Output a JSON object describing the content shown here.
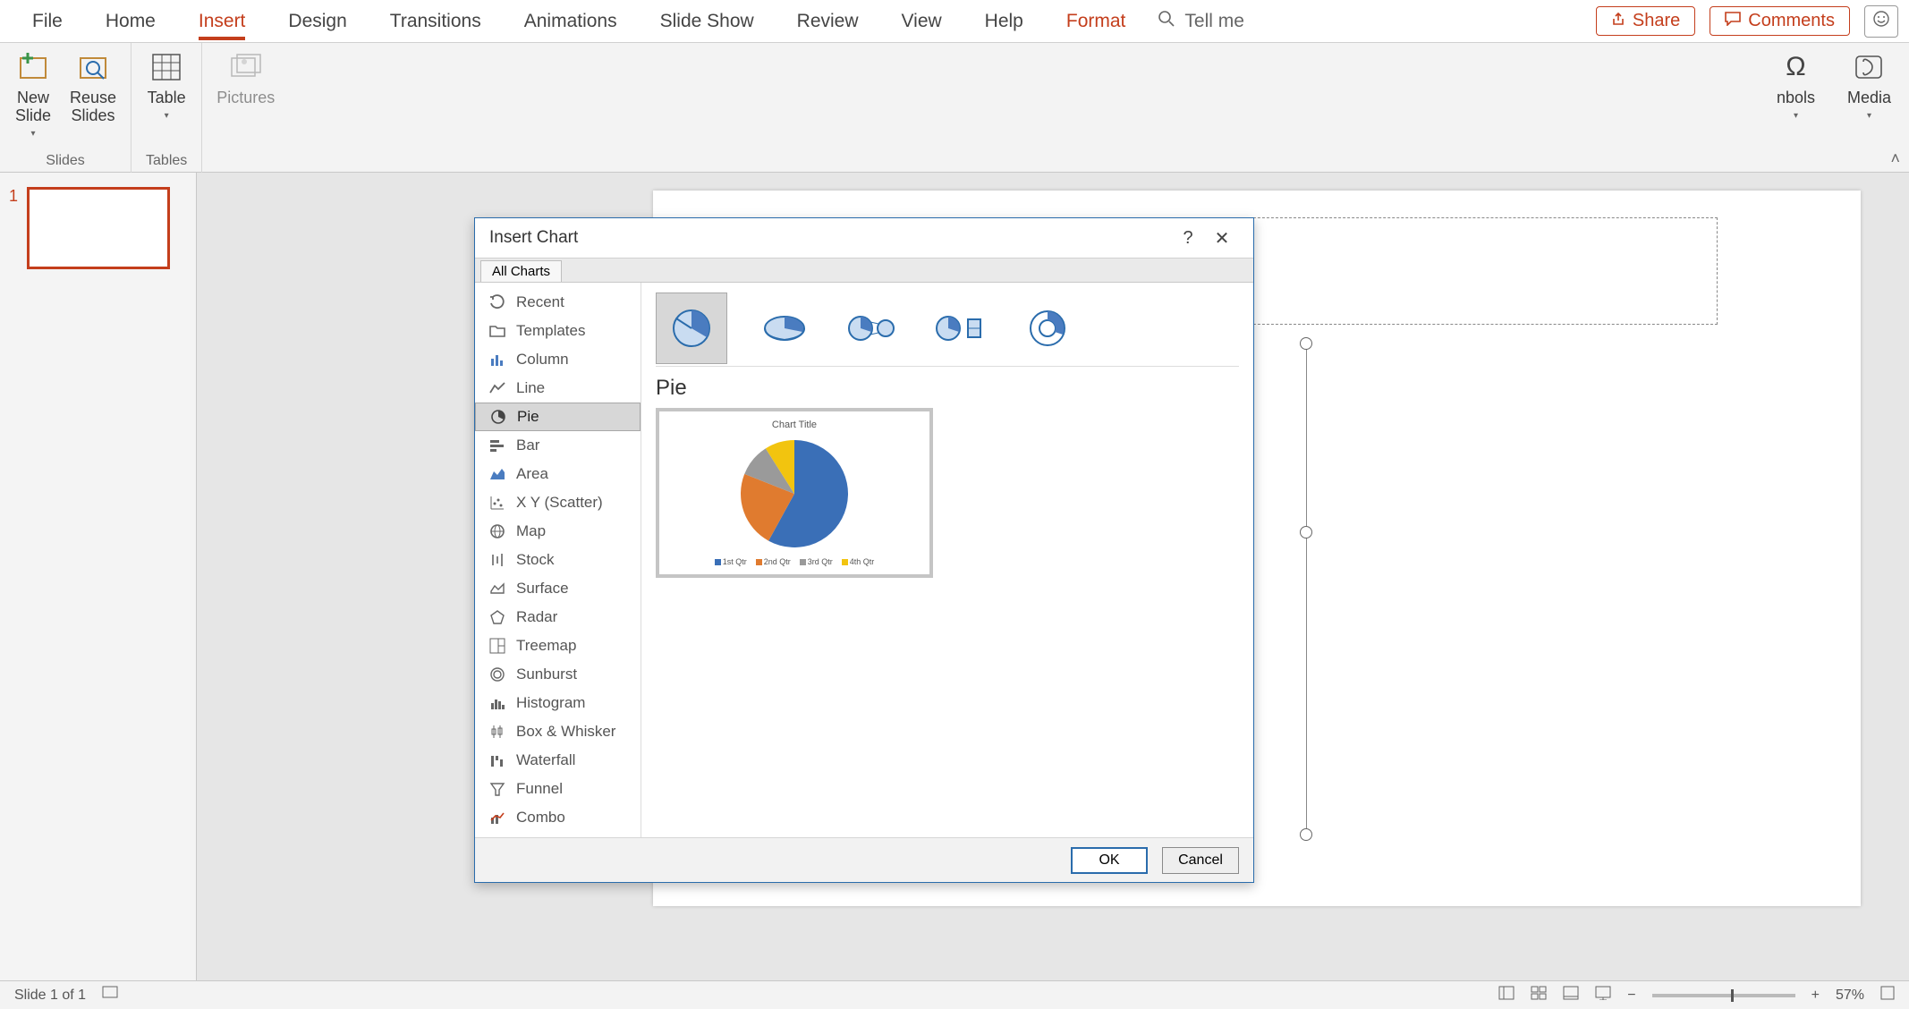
{
  "menu": {
    "items": [
      "File",
      "Home",
      "Insert",
      "Design",
      "Transitions",
      "Animations",
      "Slide Show",
      "Review",
      "View",
      "Help",
      "Format"
    ],
    "active_index": 2,
    "format_index": 10,
    "tell_me": "Tell me",
    "share": "Share",
    "comments": "Comments"
  },
  "ribbon": {
    "new_slide": "New\nSlide",
    "reuse_slides": "Reuse\nSlides",
    "slides_group": "Slides",
    "table": "Table",
    "tables_group": "Tables",
    "pictures": "Pictures",
    "symbols": "nbols",
    "media": "Media"
  },
  "dialog": {
    "title": "Insert Chart",
    "tab": "All Charts",
    "categories": [
      "Recent",
      "Templates",
      "Column",
      "Line",
      "Pie",
      "Bar",
      "Area",
      "X Y (Scatter)",
      "Map",
      "Stock",
      "Surface",
      "Radar",
      "Treemap",
      "Sunburst",
      "Histogram",
      "Box & Whisker",
      "Waterfall",
      "Funnel",
      "Combo"
    ],
    "selected_category_index": 4,
    "subtype_names": [
      "Pie",
      "3-D Pie",
      "Pie of Pie",
      "Bar of Pie",
      "Doughnut"
    ],
    "selected_subtype_index": 0,
    "chart_heading": "Pie",
    "preview_title": "Chart Title",
    "ok": "OK",
    "cancel": "Cancel"
  },
  "chart_data": {
    "type": "pie",
    "title": "Chart Title",
    "categories": [
      "1st Qtr",
      "2nd Qtr",
      "3rd Qtr",
      "4th Qtr"
    ],
    "values": [
      58,
      23,
      10,
      9
    ],
    "colors": [
      "#3a6fb7",
      "#e07b2f",
      "#9a9a9a",
      "#f2c40f"
    ],
    "legend_position": "bottom"
  },
  "thumbnail": {
    "number": "1"
  },
  "status": {
    "slide_info": "Slide 1 of 1",
    "zoom_pct": "57%"
  }
}
